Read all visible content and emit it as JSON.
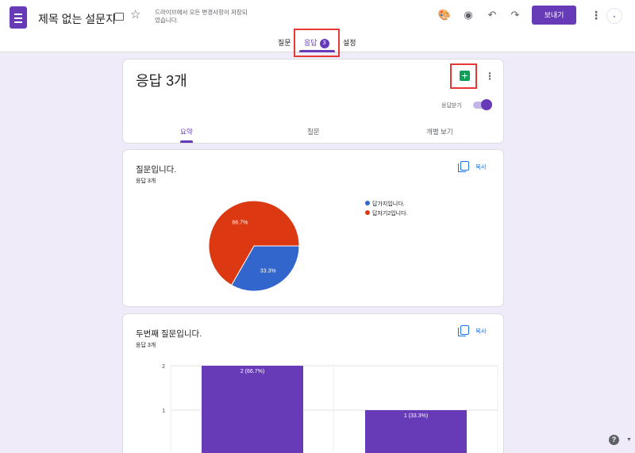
{
  "header": {
    "doc_title": "제목 없는 설문지",
    "save_status": "드라이브에서 모든 변경사항이 저장되었습니다.",
    "send_label": "보내기",
    "icons": [
      "forms-app-icon",
      "folder-icon",
      "star-icon",
      "palette-icon",
      "preview-icon",
      "undo-icon",
      "redo-icon",
      "more-vert-icon"
    ]
  },
  "tabs": [
    {
      "label": "질문"
    },
    {
      "label": "응답",
      "badge": "3"
    },
    {
      "label": "설정"
    }
  ],
  "responses": {
    "title": "응답 3개",
    "accepting_label": "응답받기",
    "accepting": true,
    "subtabs": [
      "요약",
      "질문",
      "개별 보기"
    ]
  },
  "questions": [
    {
      "title": "질문입니다.",
      "count": "응답 3개",
      "copy_label": "복사"
    },
    {
      "title": "두번째 질문입니다.",
      "count": "응답 3개",
      "copy_label": "복사"
    }
  ],
  "chart_data": [
    {
      "type": "pie",
      "labels": [
        "답가지입니다.",
        "답자기2입니다."
      ],
      "values": [
        33.3,
        66.7
      ],
      "slice_labels": [
        "33.3%",
        "66.7%"
      ],
      "colors": [
        "#3366cc",
        "#dc3912"
      ],
      "legend_position": "right"
    },
    {
      "type": "bar",
      "categories": [
        "",
        ""
      ],
      "values": [
        2,
        1
      ],
      "data_labels": [
        "2 (66.7%)",
        "1 (33.3%)"
      ],
      "yticks": [
        "1",
        "2"
      ],
      "ylim": [
        0,
        2
      ],
      "color": "#673ab7",
      "grid": true
    }
  ],
  "colors": {
    "accent": "#673ab7",
    "background": "#f0ebf8",
    "link": "#1a73e8",
    "sheets": "#0f9d58"
  }
}
